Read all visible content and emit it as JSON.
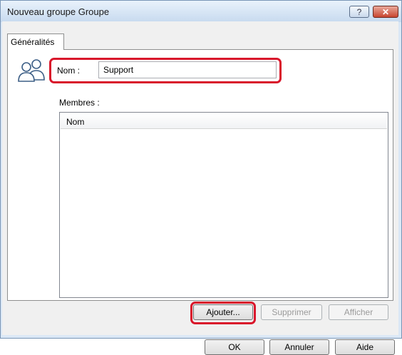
{
  "window": {
    "title": "Nouveau groupe Groupe",
    "help_glyph": "?",
    "close_glyph": "✕"
  },
  "tabs": [
    {
      "label": "Généralités"
    }
  ],
  "general": {
    "name_label": "Nom :",
    "name_value": "Support",
    "members_label": "Membres :",
    "members_column": "Nom",
    "members": []
  },
  "member_buttons": {
    "add": "Ajouter...",
    "remove": "Supprimer",
    "show": "Afficher"
  },
  "dialog_buttons": {
    "ok": "OK",
    "cancel": "Annuler",
    "help": "Aide"
  },
  "colors": {
    "highlight": "#d9162b",
    "title_bar": "#c7daef",
    "close_button": "#c8452f"
  }
}
